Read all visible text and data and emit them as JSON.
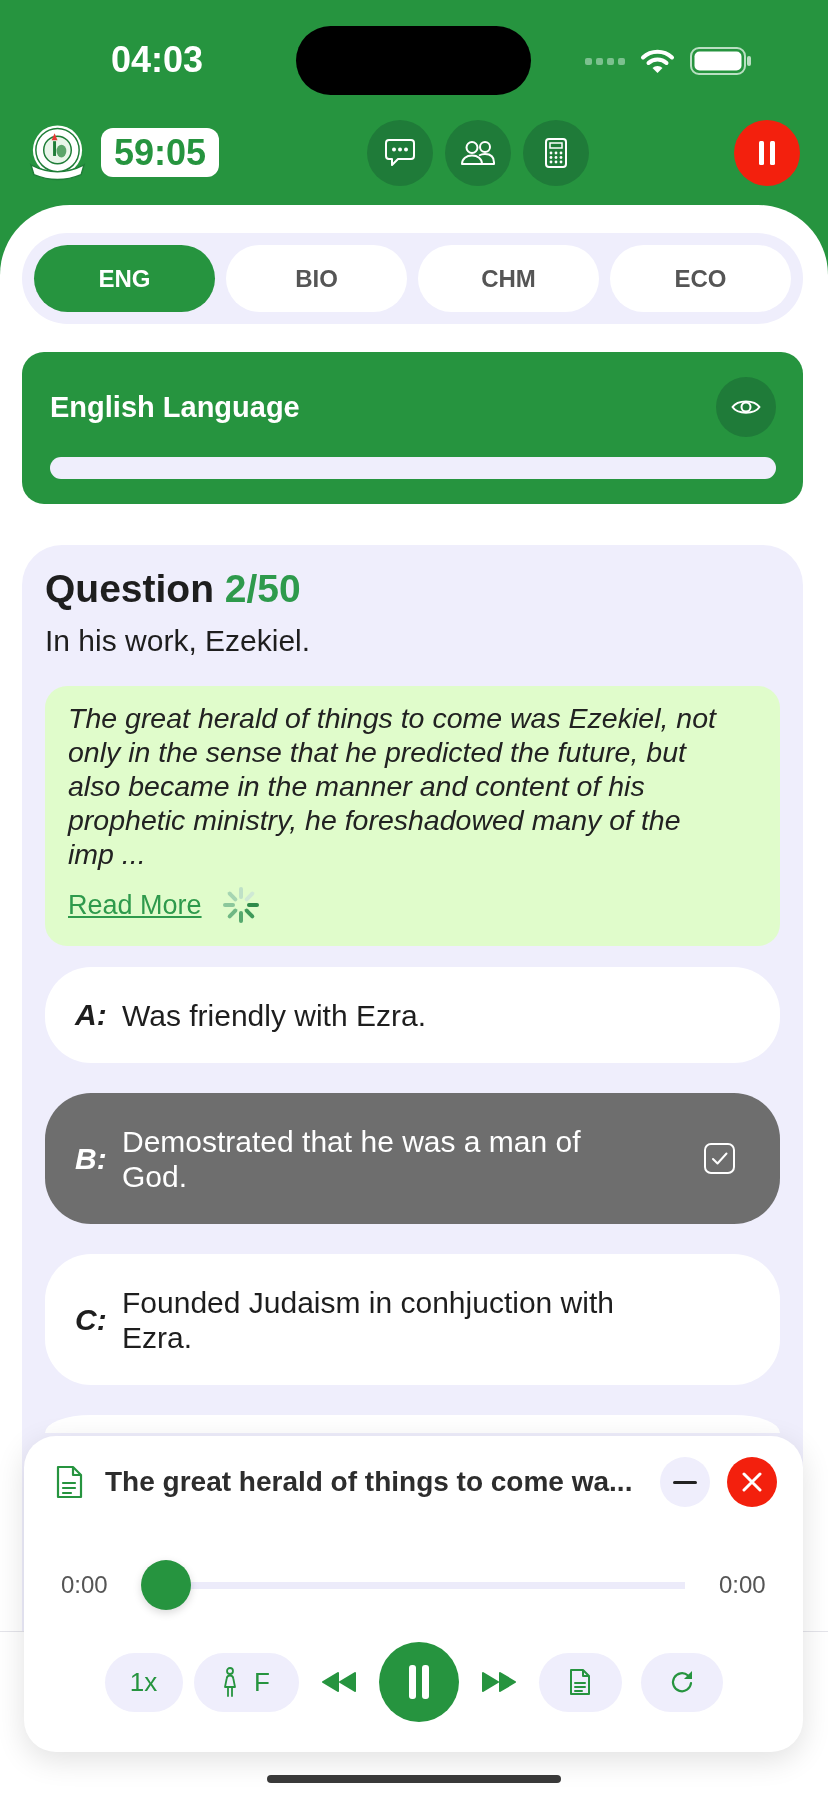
{
  "status_bar": {
    "time": "04:03"
  },
  "header": {
    "timer": "59:05"
  },
  "subject_tabs": [
    {
      "label": "ENG",
      "selected": true
    },
    {
      "label": "BIO",
      "selected": false
    },
    {
      "label": "CHM",
      "selected": false
    },
    {
      "label": "ECO",
      "selected": false
    }
  ],
  "subject_card": {
    "title": "English Language",
    "level": 0
  },
  "question": {
    "label": "Question",
    "number": "2/50",
    "prompt": "In his work, Ezekiel.",
    "passage": "The great herald of things to come was Ezekiel, not only in the sense that he predicted the future, but also became in the manner and content of his prophetic ministry, he foreshadowed many of the imp ...",
    "read_more": "Read More",
    "loading": true
  },
  "options": [
    {
      "letter": "A:",
      "text": "Was friendly with Ezra.",
      "selected": false
    },
    {
      "letter": "B:",
      "text": "Demostrated that he was a man of God.",
      "selected": true
    },
    {
      "letter": "C:",
      "text": "Founded Judaism in conhjuction with Ezra.",
      "selected": false
    }
  ],
  "player": {
    "title": "The great herald of things to come wa...",
    "elapsed": "0:00",
    "duration": "0:00",
    "level": 0,
    "playing": true,
    "speed": "1x",
    "voice": "F"
  }
}
